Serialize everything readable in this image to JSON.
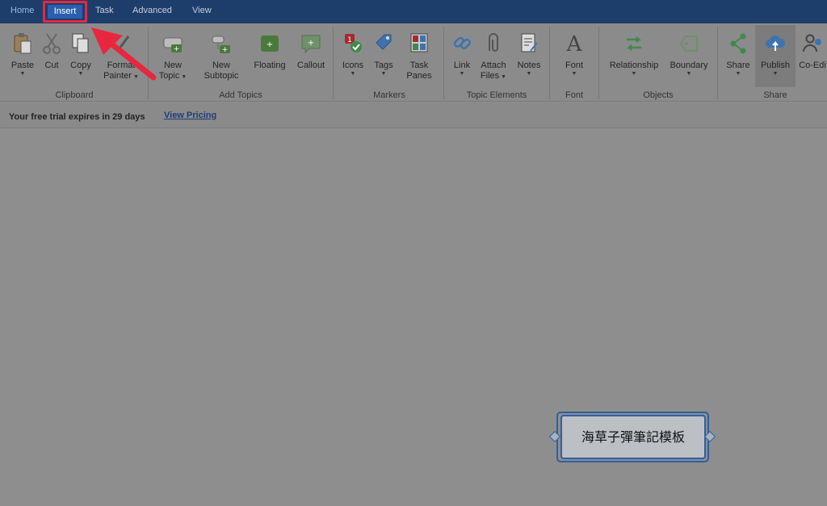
{
  "tabs": {
    "home": "Home",
    "insert": "Insert",
    "task": "Task",
    "advanced": "Advanced",
    "view": "View"
  },
  "ribbon": {
    "clipboard": {
      "group": "Clipboard",
      "paste": "Paste",
      "cut": "Cut",
      "copy": "Copy",
      "format_painter_1": "Format",
      "format_painter_2": "Painter"
    },
    "add_topics": {
      "group": "Add Topics",
      "new_topic_1": "New",
      "new_topic_2": "Topic",
      "new_subtopic_1": "New",
      "new_subtopic_2": "Subtopic",
      "floating": "Floating",
      "callout": "Callout"
    },
    "markers": {
      "group": "Markers",
      "icons": "Icons",
      "tags": "Tags",
      "task_panes_1": "Task",
      "task_panes_2": "Panes"
    },
    "topic_elements": {
      "group": "Topic Elements",
      "link": "Link",
      "attach_files_1": "Attach",
      "attach_files_2": "Files",
      "notes": "Notes"
    },
    "font": {
      "group": "Font",
      "font": "Font"
    },
    "objects": {
      "group": "Objects",
      "relationship": "Relationship",
      "boundary": "Boundary"
    },
    "share": {
      "group": "Share",
      "share": "Share",
      "publish": "Publish",
      "coedit": "Co-Edi"
    }
  },
  "trial": {
    "message": "Your free trial expires in 29 days",
    "link": "View Pricing"
  },
  "canvas": {
    "central_topic": "海草子彈筆記模板"
  },
  "colors": {
    "tabbar": "#1d3d6b",
    "active_tab": "#2a5fae",
    "highlight": "#e8273e",
    "topic_border": "#2d5fa3"
  }
}
